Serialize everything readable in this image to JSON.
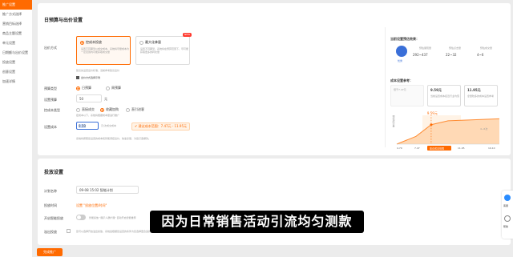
{
  "sidebar": {
    "items": [
      {
        "label": "推广设置",
        "active": true
      },
      {
        "label": "推广方式选择"
      },
      {
        "label": "营销目标选择"
      },
      {
        "label": "商品主题设置"
      },
      {
        "label": "单元设置"
      },
      {
        "label": "日期额与出价设置"
      },
      {
        "label": "投放设置"
      },
      {
        "label": "创意设置"
      },
      {
        "label": "加速详情"
      }
    ]
  },
  "budget_card": {
    "title": "日预算与出价设置",
    "bid_mode_label": "出价方式",
    "option1": {
      "title": "控成本投放",
      "desc": "设置不同期望以成交成本，系统将尽量成本为一定范围内可能获取成交量"
    },
    "option2": {
      "title": "最大化拿量",
      "badge": "NEW",
      "desc": "设置不同期望，系统将在预算范围下，尽可能获取更多的转化量"
    },
    "hint1": "建议先设置出价标准，当前参考建议出价",
    "hint2": "出价方式选择示例",
    "budget_type_label": "预算类型",
    "budget_type_opt1": "日预算",
    "budget_type_opt2": "周预算",
    "budget_label": "设置预算",
    "budget_value": "50",
    "budget_unit": "元",
    "cost_type_label": "控成本类型",
    "cost_opt1": "直接成交",
    "cost_opt2": "收藏加购",
    "cost_opt3": "直引进客",
    "cost_hint": "控成本以下，系统将根据成本量进行推广",
    "cost_set_label": "设置成本",
    "cost_value": "9.59",
    "cost_unit": "元/次成交成本",
    "suggest_text": "建议成本范围：7.47元 - 11.95元",
    "bottom_hint": "系统将按照您设置的成本和智能调控出价，快速拿量，为您打造爆款。"
  },
  "right_panel": {
    "title": "当前设置预估效果：",
    "stat1_label": "预估展现量",
    "stat1_value": "292~437",
    "stat2_label": "预估点击量",
    "stat2_value": "22~32",
    "stat3_label": "预估成交量",
    "stat3_value": "4~6",
    "badge": "优秀",
    "ref_title": "成本设置参考：",
    "ref1_value": "9.59元",
    "ref1_desc": "当前设置成本接近行业均值",
    "ref2_value": "11.95元",
    "ref2_desc": "拿量较多的成本设置参考",
    "ref0_value": "低于7.47元",
    "chart_marker": "9.59元",
    "chart_range": "4~6次",
    "chart_axis": [
      "4.79",
      "7.47",
      "11.95",
      "19.10"
    ],
    "chart_badge": "建议成本范围"
  },
  "chart_data": {
    "type": "area",
    "x": [
      4.79,
      7.47,
      9.59,
      11.95,
      19.1
    ],
    "values": [
      0,
      2,
      5,
      6,
      6.5
    ],
    "title": "",
    "xlabel": "",
    "ylabel": "预估成交量"
  },
  "delivery_card": {
    "title": "投放设置",
    "plan_name_label": "计划名称",
    "plan_name_value": "09-08 15:02 智能计划",
    "time_label": "投放时间",
    "time_value": "设置 \"投放位置/时间\"",
    "smart_label": "开启智能投放",
    "smart_desc": "智能投放 \"展示人群扩展\" 自动开启智能推荐",
    "spread_label": "溢出投放",
    "spread_desc": "您可以选择开启溢出投放，系统会根据您设置的条件为您选择更合适的推广"
  },
  "footer": {
    "primary_button": "完成推广"
  },
  "subtitle": "因为日常销售活动引流均匀测款",
  "float_panel": {
    "item1": "客服",
    "item2": "帮助"
  },
  "colors": {
    "accent": "#ff6a00",
    "badge_blue": "#3a6fd8"
  }
}
